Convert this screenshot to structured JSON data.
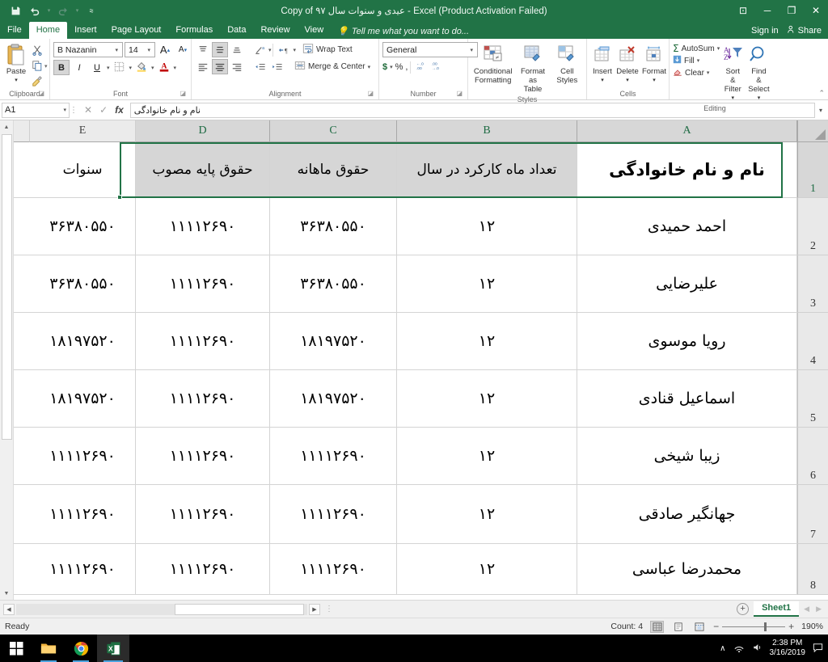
{
  "titlebar": {
    "title": "Copy of عیدی و سنوات سال ۹۷  -  Excel (Product Activation Failed)",
    "qat": [
      {
        "name": "save-icon",
        "label": "Save"
      },
      {
        "name": "undo-icon",
        "label": "Undo"
      },
      {
        "name": "redo-icon",
        "label": "Redo"
      },
      {
        "name": "customize-qat-icon",
        "label": "Customize Quick Access Toolbar"
      }
    ],
    "controls": {
      "ribbon_display": "⊡",
      "minimize": "─",
      "restore": "❐",
      "close": "✕"
    }
  },
  "tabs": {
    "items": [
      "File",
      "Home",
      "Insert",
      "Page Layout",
      "Formulas",
      "Data",
      "Review",
      "View"
    ],
    "active": "Home",
    "tellme": "Tell me what you want to do...",
    "signin": "Sign in",
    "share": "Share"
  },
  "ribbon": {
    "clipboard": {
      "label": "Clipboard",
      "paste": "Paste",
      "cut": "Cut",
      "copy": "Copy",
      "format_painter": "Format Painter"
    },
    "font": {
      "label": "Font",
      "family": "B Nazanin",
      "size": "14",
      "grow": "A",
      "shrink": "A",
      "bold": "B",
      "italic": "I",
      "underline": "U",
      "borders": "Borders",
      "fill_color": "Fill Color",
      "font_color": "Font Color"
    },
    "alignment": {
      "label": "Alignment",
      "wrap_text": "Wrap Text",
      "merge_center": "Merge & Center",
      "orientation": "Orientation",
      "rtl": "Right-to-Left"
    },
    "number": {
      "label": "Number",
      "format": "General",
      "accounting": "$",
      "percent": "%",
      "comma": ",",
      "inc_dec": "Increase Decimal",
      "dec_dec": "Decrease Decimal"
    },
    "styles": {
      "label": "Styles",
      "conditional": "Conditional\nFormatting",
      "conditional_l1": "Conditional",
      "conditional_l2": "Formatting",
      "table_l1": "Format as",
      "table_l2": "Table",
      "cellstyles_l1": "Cell",
      "cellstyles_l2": "Styles"
    },
    "cells": {
      "label": "Cells",
      "insert": "Insert",
      "delete": "Delete",
      "format": "Format"
    },
    "editing": {
      "label": "Editing",
      "autosum": "AutoSum",
      "fill": "Fill",
      "clear": "Clear",
      "sort_l1": "Sort &",
      "sort_l2": "Filter",
      "find_l1": "Find &",
      "find_l2": "Select"
    }
  },
  "formulabar": {
    "namebox": "A1",
    "cancel": "✕",
    "enter": "✓",
    "fx": "fx",
    "content": "نام و نام خانوادگی",
    "expand": "▾"
  },
  "grid": {
    "columns": [
      "E",
      "D",
      "C",
      "B",
      "A"
    ],
    "rownums": [
      "1",
      "2",
      "3",
      "4",
      "5",
      "6",
      "7",
      "8"
    ],
    "headers": {
      "A": "نام و نام خانوادگی",
      "B": "تعداد ماه کارکرد در سال",
      "C": "حقوق ماهانه",
      "D": "حقوق پایه مصوب",
      "E": "سنوات"
    },
    "rows": [
      {
        "A": "احمد حمیدی",
        "B": "۱۲",
        "C": "۳۶۳۸۰۵۵۰",
        "D": "۱۱۱۱۲۶۹۰",
        "E": "۳۶۳۸۰۵۵۰"
      },
      {
        "A": "علیرضایی",
        "B": "۱۲",
        "C": "۳۶۳۸۰۵۵۰",
        "D": "۱۱۱۱۲۶۹۰",
        "E": "۳۶۳۸۰۵۵۰"
      },
      {
        "A": "رویا موسوی",
        "B": "۱۲",
        "C": "۱۸۱۹۷۵۲۰",
        "D": "۱۱۱۱۲۶۹۰",
        "E": "۱۸۱۹۷۵۲۰"
      },
      {
        "A": "اسماعیل قنادی",
        "B": "۱۲",
        "C": "۱۸۱۹۷۵۲۰",
        "D": "۱۱۱۱۲۶۹۰",
        "E": "۱۸۱۹۷۵۲۰"
      },
      {
        "A": "زیبا شیخی",
        "B": "۱۲",
        "C": "۱۱۱۱۲۶۹۰",
        "D": "۱۱۱۱۲۶۹۰",
        "E": "۱۱۱۱۲۶۹۰"
      },
      {
        "A": "جهانگیر صادقی",
        "B": "۱۲",
        "C": "۱۱۱۱۲۶۹۰",
        "D": "۱۱۱۱۲۶۹۰",
        "E": "۱۱۱۱۲۶۹۰"
      },
      {
        "A": "محمدرضا عباسی",
        "B": "۱۲",
        "C": "۱۱۱۱۲۶۹۰",
        "D": "۱۱۱۱۲۶۹۰",
        "E": "۱۱۱۱۲۶۹۰"
      }
    ]
  },
  "sheettabs": {
    "add": "+",
    "active": "Sheet1",
    "prev": "◀",
    "next": "▶"
  },
  "statusbar": {
    "mode": "Ready",
    "count": "Count: 4",
    "normal_view": "Normal",
    "pagelayout_view": "Page Layout",
    "pagebreak_view": "Page Break Preview",
    "zoom_out": "−",
    "zoom_in": "+",
    "zoom": "190%"
  },
  "taskbar": {
    "start": "start-button",
    "explorer": "file-explorer",
    "chrome": "google-chrome",
    "excel": "microsoft-excel",
    "time": "2:38 PM",
    "date": "3/16/2019",
    "caret": "∧",
    "network": "network-icon",
    "volume": "volume-icon",
    "action_center": "action-center-icon"
  },
  "colors": {
    "excel_green": "#217346",
    "selection_green": "#217346",
    "header_grey": "#d7d7d7"
  }
}
